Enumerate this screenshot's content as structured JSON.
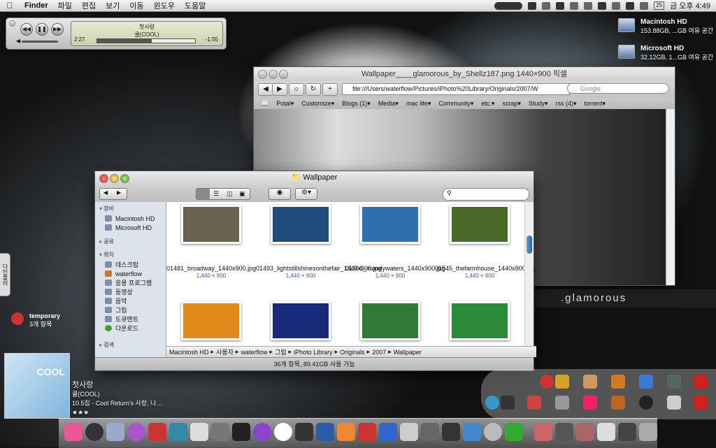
{
  "menubar": {
    "app": "Finder",
    "items": [
      "파일",
      "편집",
      "보기",
      "이동",
      "윈도우",
      "도움말"
    ],
    "day": "25",
    "clock": "금 오후 4:49"
  },
  "itunes": {
    "song": "첫사랑",
    "artist": "쿨(COOL)",
    "elapsed": "2:27",
    "remaining": "-1:55",
    "progress": 0.56
  },
  "desktop": {
    "disks": [
      {
        "name": "Macintosh HD",
        "info": "153.88GB, ...GB 여유 공간"
      },
      {
        "name": "Microsoft HD",
        "info": "32.12GB, 1...GB 여유 공간"
      }
    ],
    "glamorous": ".glamorous",
    "side_tab": "다인플러",
    "temporary": {
      "title": "temporary",
      "sub": "3개 항목"
    },
    "album_text": "COOL",
    "track": {
      "title": "첫사랑",
      "artist": "쿨(COOL)",
      "album": "10.5집 - Cool Return's 사랑, 나…",
      "rating": "★★★"
    }
  },
  "browser": {
    "title": "Wallpaper____glamorous_by_Shellz187.png 1440×900 픽셀",
    "url": "file:///Users/waterflow/Pictures/iPhoto%20Library/Originals/2007/W",
    "search_placeholder": "Google",
    "bookmarks": [
      "Potal▾",
      "Customize▾",
      "Blogs (1)▾",
      "Media▾",
      "mac life▾",
      "Community▾",
      "etc.▾",
      "scrap▾",
      "Study▾",
      "rss (4)▾",
      "torrent▾"
    ]
  },
  "finder": {
    "title": "Wallpaper",
    "sidebar": {
      "devices_header": "장비",
      "devices": [
        "Macintosh HD",
        "Microsoft HD"
      ],
      "shared_header": "공유",
      "places_header": "위치",
      "places": [
        "데스크탑",
        "waterflow",
        "응용 프로그램",
        "동영상",
        "음악",
        "그림",
        "도큐멘트",
        "다운로드"
      ],
      "search_header": "검색"
    },
    "files": [
      {
        "name": "01481_broadway_1440x900.jpg",
        "size": "1,440 × 900",
        "color": "#6b6151"
      },
      {
        "name": "01493_lightstillshinesonthefair_1440x900.jpg",
        "size": "1,440 × 900",
        "color": "#1f4c7a"
      },
      {
        "name": "01506_moodywaters_1440x900.jpg",
        "size": "1,440 × 900",
        "color": "#2f6fb0"
      },
      {
        "name": "01545_thefarmhouse_1440x900.jpg",
        "size": "1,440 × 900",
        "color": "#4a6a2a"
      },
      {
        "name": "",
        "size": "",
        "color": "#e08a1c"
      },
      {
        "name": "",
        "size": "",
        "color": "#1a2a7a"
      },
      {
        "name": "",
        "size": "",
        "color": "#2f7a34"
      },
      {
        "name": "",
        "size": "",
        "color": "#2a8a3a"
      }
    ],
    "path": [
      "Macintosh HD",
      "사용자",
      "waterflow",
      "그림",
      "iPhoto Library",
      "Originals",
      "2007",
      "Wallpaper"
    ],
    "status": "36개 항목, 89.41GB 사용 가능"
  },
  "colors": {
    "accent": "#3a62b0",
    "menubar": "#e0e0e0"
  }
}
